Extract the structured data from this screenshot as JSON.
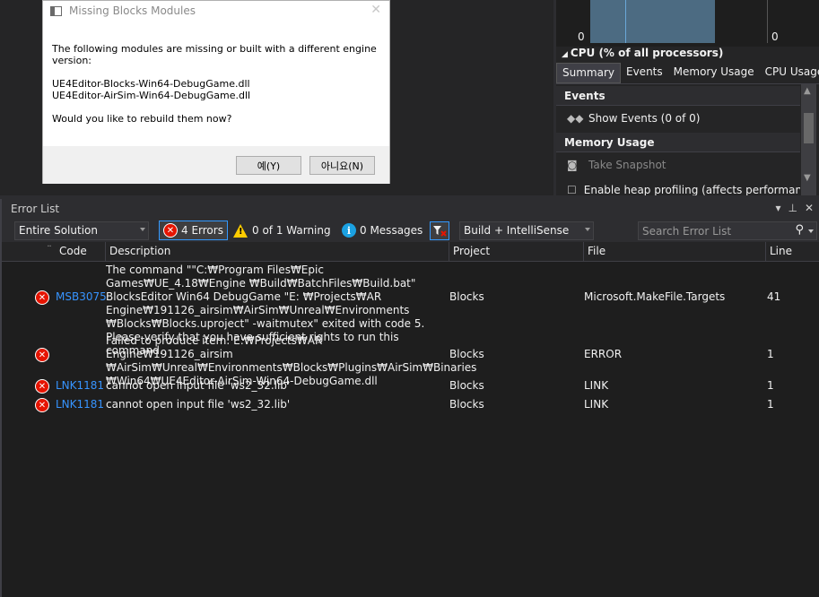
{
  "dialog": {
    "title": "Missing Blocks Modules",
    "message": "The following modules are missing or built with a different engine version:",
    "modules": [
      "UE4Editor-Blocks-Win64-DebugGame.dll",
      "UE4Editor-AirSim-Win64-DebugGame.dll"
    ],
    "question": "Would you like to rebuild them now?",
    "yes_label": "예(Y)",
    "no_label": "아니요(N)",
    "close_glyph": "✕"
  },
  "diagnostics": {
    "cpu_zero_left": "0",
    "cpu_zero_right": "0",
    "cpu_label": "CPU (% of all processors)",
    "tabs": [
      "Summary",
      "Events",
      "Memory Usage",
      "CPU Usage"
    ],
    "events_header": "Events",
    "show_events": "Show Events (0 of 0)",
    "memory_header": "Memory Usage",
    "take_snapshot": "Take Snapshot",
    "enable_heap": "Enable heap profiling (affects performance)"
  },
  "error_list": {
    "title": "Error List",
    "scope": "Entire Solution",
    "errors_label": "4 Errors",
    "warnings_label": "0 of 1 Warning",
    "messages_label": "0 Messages",
    "build_filter": "Build + IntelliSense",
    "search_placeholder": "Search Error List",
    "columns": {
      "code": "Code",
      "description": "Description",
      "project": "Project",
      "file": "File",
      "line": "Line"
    },
    "rows": [
      {
        "code": "MSB3075",
        "description": "The command \"\"C:₩Program Files₩Epic Games₩UE_4.18₩Engine ₩Build₩BatchFiles₩Build.bat\" BlocksEditor Win64 DebugGame \"E: ₩Projects₩AR Engine₩191126_airsim₩AirSim₩Unreal₩Environments ₩Blocks₩Blocks.uproject\" -waitmutex\" exited with code 5. Please verify that you have sufficient rights to run this command.",
        "project": "Blocks",
        "file": "Microsoft.MakeFile.Targets",
        "line": "41"
      },
      {
        "code": "",
        "description": "Failed to produce item: E:₩Projects₩AR Engine₩191126_airsim ₩AirSim₩Unreal₩Environments₩Blocks₩Plugins₩AirSim₩Binaries ₩Win64₩UE4Editor-AirSim-Win64-DebugGame.dll",
        "project": "Blocks",
        "file": "ERROR",
        "line": "1"
      },
      {
        "code": "LNK1181",
        "description": "cannot open input file 'ws2_32.lib'",
        "project": "Blocks",
        "file": "LINK",
        "line": "1"
      },
      {
        "code": "LNK1181",
        "description": "cannot open input file 'ws2_32.lib'",
        "project": "Blocks",
        "file": "LINK",
        "line": "1"
      }
    ]
  },
  "colors": {
    "error": "#e51400",
    "link": "#3794ff",
    "accent": "#3399ff"
  }
}
